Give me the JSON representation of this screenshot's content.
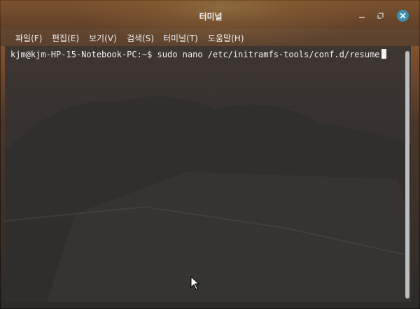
{
  "window": {
    "title": "터미널",
    "controls": {
      "minimize": "minimize-icon",
      "maximize": "maximize-icon",
      "close": "close-icon"
    }
  },
  "menu": {
    "items": [
      {
        "label": "파일(F)"
      },
      {
        "label": "편집(E)"
      },
      {
        "label": "보기(V)"
      },
      {
        "label": "검색(S)"
      },
      {
        "label": "터미널(T)"
      },
      {
        "label": "도움말(H)"
      }
    ]
  },
  "terminal": {
    "prompt": "kjm@kjm-HP-15-Notebook-PC:~$",
    "command": "sudo nano /etc/initramfs-tools/conf.d/resume"
  },
  "colors": {
    "close_button": "#3d8fb0",
    "terminal_bg": "#343232",
    "text": "#f2f2f2"
  }
}
